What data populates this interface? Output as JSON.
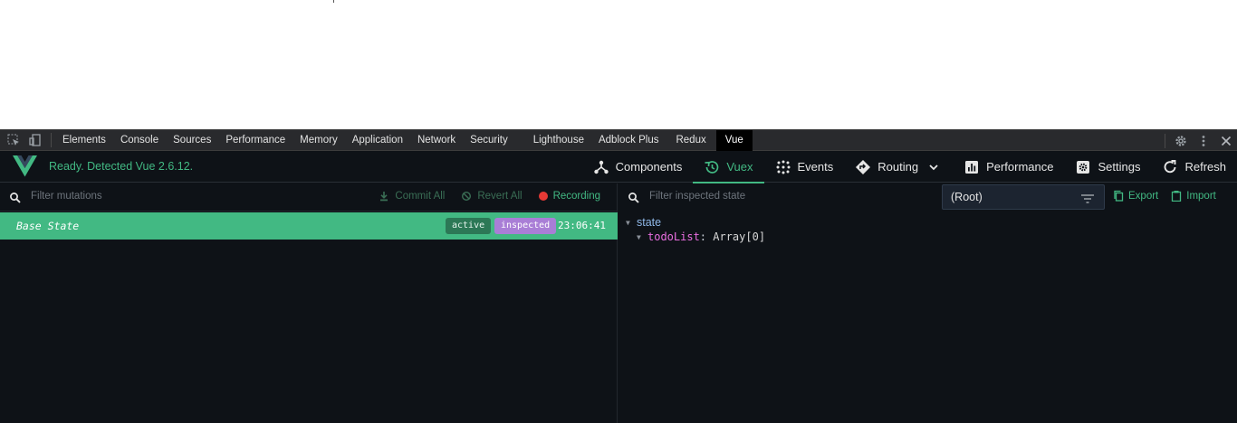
{
  "devtools": {
    "tabs": [
      "Elements",
      "Console",
      "Sources",
      "Performance",
      "Memory",
      "Application",
      "Network",
      "Security",
      "Lighthouse",
      "Adblock Plus",
      "Redux",
      "Vue"
    ],
    "active_tab": "Vue"
  },
  "vue": {
    "status": "Ready. Detected Vue 2.6.12.",
    "nav": {
      "components": "Components",
      "vuex": "Vuex",
      "events": "Events",
      "routing": "Routing",
      "performance": "Performance",
      "settings": "Settings",
      "refresh": "Refresh"
    },
    "active_nav": "Vuex",
    "accent_color": "#42b983"
  },
  "mutations": {
    "filter_placeholder": "Filter mutations",
    "commit_all": "Commit All",
    "revert_all": "Revert All",
    "recording": "Recording",
    "rows": [
      {
        "name": "Base State",
        "badges": [
          "active",
          "inspected"
        ],
        "time": "23:06:41"
      }
    ]
  },
  "inspector": {
    "filter_placeholder": "Filter inspected state",
    "root_select": "(Root)",
    "export": "Export",
    "import": "Import",
    "tree": {
      "root": "state",
      "key": "todoList",
      "value": "Array[0]"
    }
  }
}
